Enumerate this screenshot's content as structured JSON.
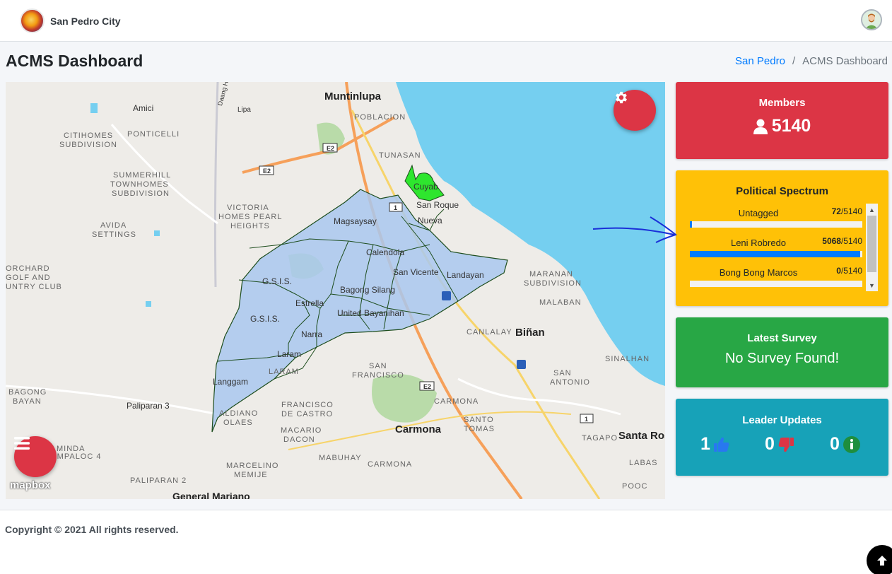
{
  "navbar": {
    "brand_name": "San Pedro City"
  },
  "header": {
    "page_title": "ACMS Dashboard",
    "breadcrumb": [
      "San Pedro",
      "ACMS Dashboard"
    ],
    "breadcrumb_separator": "/"
  },
  "map": {
    "attribution": "mapbox",
    "labels": [
      {
        "text": "Muntinlupa",
        "kind": "big"
      },
      {
        "text": "POBLACION",
        "kind": "caps"
      },
      {
        "text": "TUNASAN",
        "kind": "caps"
      },
      {
        "text": "Amici",
        "kind": "normal"
      },
      {
        "text": "Lipa",
        "kind": "normal"
      },
      {
        "text": "Daang Hari",
        "kind": "normal"
      },
      {
        "text": "CITIHOMES",
        "kind": "caps"
      },
      {
        "text": "SUBDIVISION",
        "kind": "caps"
      },
      {
        "text": "PONTICELLI",
        "kind": "caps"
      },
      {
        "text": "SUMMERHILL",
        "kind": "caps"
      },
      {
        "text": "TOWNHOMES",
        "kind": "caps"
      },
      {
        "text": "SUBDIVISION",
        "kind": "caps"
      },
      {
        "text": "AVIDA",
        "kind": "caps"
      },
      {
        "text": "SETTINGS",
        "kind": "caps"
      },
      {
        "text": "VICTORIA",
        "kind": "caps"
      },
      {
        "text": "HOMES PEARL",
        "kind": "caps"
      },
      {
        "text": "HEIGHTS",
        "kind": "caps"
      },
      {
        "text": "ORCHARD",
        "kind": "caps"
      },
      {
        "text": "GOLF AND",
        "kind": "caps"
      },
      {
        "text": "UNTRY CLUB",
        "kind": "caps"
      },
      {
        "text": "Cuyab",
        "kind": "normal"
      },
      {
        "text": "San Roque",
        "kind": "normal"
      },
      {
        "text": "Nueva",
        "kind": "normal"
      },
      {
        "text": "Magsaysay",
        "kind": "normal"
      },
      {
        "text": "Calendola",
        "kind": "normal"
      },
      {
        "text": "San Vicente",
        "kind": "normal"
      },
      {
        "text": "Landayan",
        "kind": "normal"
      },
      {
        "text": "G.S.I.S.",
        "kind": "normal"
      },
      {
        "text": "Bagong Silang",
        "kind": "normal"
      },
      {
        "text": "Estrella",
        "kind": "normal"
      },
      {
        "text": "United Bayanihan",
        "kind": "normal"
      },
      {
        "text": "G.S.I.S.",
        "kind": "normal"
      },
      {
        "text": "Narra",
        "kind": "normal"
      },
      {
        "text": "Laram",
        "kind": "normal"
      },
      {
        "text": "LARAM",
        "kind": "caps"
      },
      {
        "text": "Langgam",
        "kind": "normal"
      },
      {
        "text": "MARANAN",
        "kind": "caps"
      },
      {
        "text": "SUBDIVISION",
        "kind": "caps"
      },
      {
        "text": "MALABAN",
        "kind": "caps"
      },
      {
        "text": "CANLALAY",
        "kind": "caps"
      },
      {
        "text": "Biñan",
        "kind": "big"
      },
      {
        "text": "SINALHAN",
        "kind": "caps"
      },
      {
        "text": "SAN",
        "kind": "caps"
      },
      {
        "text": "ANTONIO",
        "kind": "caps"
      },
      {
        "text": "SAN",
        "kind": "caps"
      },
      {
        "text": "FRANCISCO",
        "kind": "caps"
      },
      {
        "text": "FRANCISCO",
        "kind": "caps"
      },
      {
        "text": "DE CASTRO",
        "kind": "caps"
      },
      {
        "text": "CARMONA",
        "kind": "caps"
      },
      {
        "text": "BAGONG",
        "kind": "caps"
      },
      {
        "text": "BAYAN",
        "kind": "caps"
      },
      {
        "text": "Paliparan 3",
        "kind": "normal"
      },
      {
        "text": "ALDIANO",
        "kind": "caps"
      },
      {
        "text": "OLAES",
        "kind": "caps"
      },
      {
        "text": "MACARIO",
        "kind": "caps"
      },
      {
        "text": "DACON",
        "kind": "caps"
      },
      {
        "text": "Carmona",
        "kind": "big"
      },
      {
        "text": "SANTO",
        "kind": "caps"
      },
      {
        "text": "TOMAS",
        "kind": "caps"
      },
      {
        "text": "TAGAPO",
        "kind": "caps"
      },
      {
        "text": "Santa Ros",
        "kind": "big"
      },
      {
        "text": "LABAS",
        "kind": "caps"
      },
      {
        "text": "POOC",
        "kind": "caps"
      },
      {
        "text": "MABUHAY",
        "kind": "caps"
      },
      {
        "text": "CARMONA",
        "kind": "caps"
      },
      {
        "text": "MARCELINO",
        "kind": "caps"
      },
      {
        "text": "MEMIJE",
        "kind": "caps"
      },
      {
        "text": "PALIPARAN 2",
        "kind": "caps"
      },
      {
        "text": "General Mariano",
        "kind": "big"
      },
      {
        "text": "MINDA",
        "kind": "caps"
      },
      {
        "text": "SAMPALOC 4",
        "kind": "caps"
      },
      {
        "text": "E2",
        "kind": "shield"
      },
      {
        "text": "E2",
        "kind": "shield"
      },
      {
        "text": "E2",
        "kind": "shield"
      },
      {
        "text": "1",
        "kind": "shield"
      },
      {
        "text": "1",
        "kind": "shield"
      }
    ]
  },
  "cards": {
    "members": {
      "title": "Members",
      "count": "5140",
      "icon": "user-icon"
    },
    "spectrum": {
      "title": "Political Spectrum",
      "items": [
        {
          "label": "Untagged",
          "count": "72",
          "total": "/5140",
          "fraction": 0.014
        },
        {
          "label": "Leni Robredo",
          "count": "5068",
          "total": "/5140",
          "fraction": 0.986
        },
        {
          "label": "Bong Bong Marcos",
          "count": "0",
          "total": "/5140",
          "fraction": 0.0
        }
      ]
    },
    "survey": {
      "title": "Latest Survey",
      "status": "No Survey Found!"
    },
    "leader": {
      "title": "Leader Updates",
      "likes": "1",
      "dislikes": "0",
      "info": "0"
    }
  },
  "footer": {
    "copyright": "Copyright © 2021 All rights reserved."
  },
  "colors": {
    "danger": "#dc3545",
    "warning": "#ffc107",
    "success": "#28a745",
    "info": "#17a2b8",
    "primary": "#007bff",
    "water": "#75cff0",
    "district_fill": "#a9c8ee",
    "cuyab_fill": "#2ee62e"
  }
}
